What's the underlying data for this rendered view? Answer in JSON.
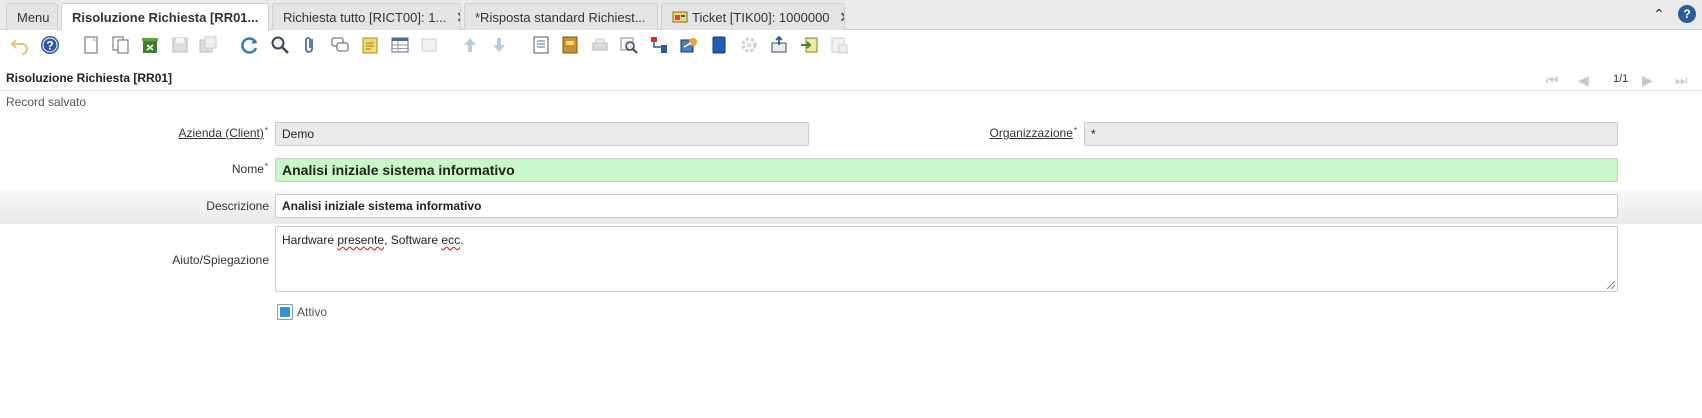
{
  "tabs": [
    {
      "label": "Menu"
    },
    {
      "label": "Risoluzione Richiesta [RR01..."
    },
    {
      "label": "Richiesta tutto [RICT00]: 1..."
    },
    {
      "label": "*Risposta standard Richiest..."
    },
    {
      "label": "Ticket [TIK00]: 1000000"
    }
  ],
  "icons": {
    "toolbar": [
      "undo-icon",
      "help-icon",
      "new-record-icon",
      "copy-record-icon",
      "delete-icon",
      "save-icon",
      "save-new-icon",
      "refresh-icon",
      "find-icon",
      "attachment-icon",
      "chat-icon",
      "notes-icon",
      "grid-toggle-icon",
      "parent-icon",
      "previous-record-icon",
      "next-record-icon",
      "report-icon",
      "archive-icon",
      "print-icon",
      "zoom-across-icon",
      "workflow-icon",
      "request-icon",
      "product-info-icon",
      "process-icon",
      "export-icon",
      "import-icon",
      "window-settings-icon"
    ]
  },
  "window": {
    "title": "Risoluzione Richiesta [RR01]",
    "record_position": "1/1",
    "status": "Record salvato"
  },
  "form": {
    "client_label": "Azienda (Client)",
    "client_value": "Demo",
    "org_label": "Organizzazione",
    "org_value": "*",
    "name_label": "Nome",
    "name_value": "Analisi iniziale sistema informativo",
    "description_label": "Descrizione",
    "description_value": "Analisi iniziale sistema informativo",
    "help_label": "Aiuto/Spiegazione",
    "help_value_part1": "Hardware ",
    "help_value_word1": "presente",
    "help_value_part2": ", Software ",
    "help_value_word2": "ecc",
    "help_value_part3": ".",
    "active_label": "Attivo",
    "active_checked": true
  },
  "colors": {
    "accent": "#2a5d98",
    "required_field": "#c8f7c8",
    "readonly_field": "#eaeaea"
  }
}
